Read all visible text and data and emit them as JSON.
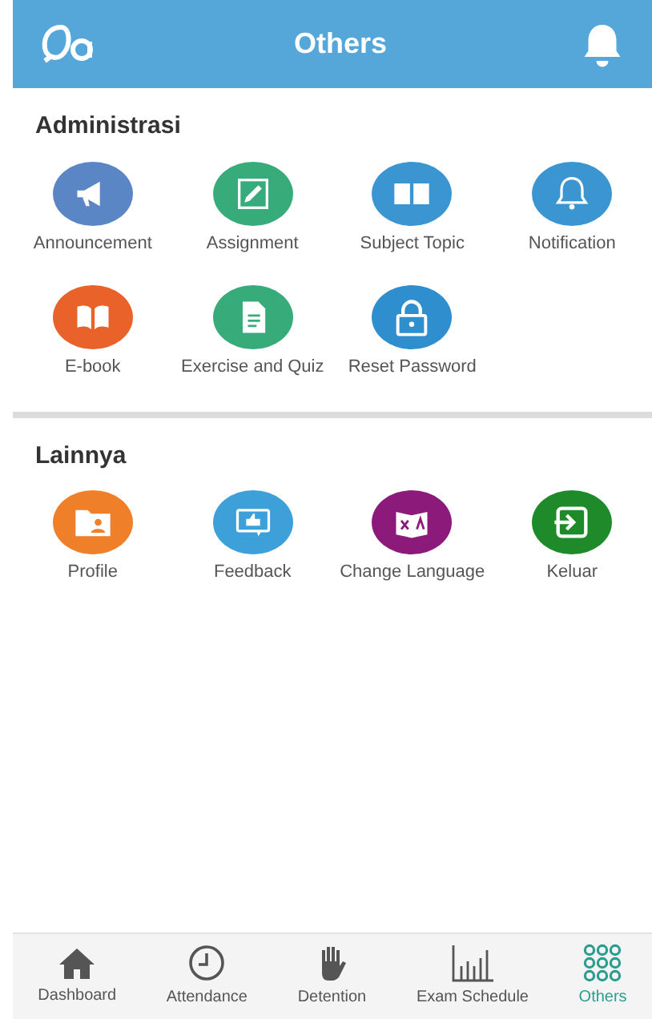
{
  "header": {
    "title": "Others"
  },
  "sections": [
    {
      "title": "Administrasi",
      "items": [
        {
          "label": "Announcement",
          "color": "#5b86c5"
        },
        {
          "label": "Assignment",
          "color": "#38ab7b"
        },
        {
          "label": "Subject Topic",
          "color": "#3b95d0"
        },
        {
          "label": "Notification",
          "color": "#3b95d0"
        },
        {
          "label": "E-book",
          "color": "#e8622a"
        },
        {
          "label": "Exercise and Quiz",
          "color": "#38ab7b"
        },
        {
          "label": "Reset Password",
          "color": "#2f8fce"
        }
      ]
    },
    {
      "title": "Lainnya",
      "items": [
        {
          "label": "Profile",
          "color": "#f07f2a"
        },
        {
          "label": "Feedback",
          "color": "#3da0d8"
        },
        {
          "label": "Change Language",
          "color": "#8b1a7a"
        },
        {
          "label": "Keluar",
          "color": "#1f8a2a"
        }
      ]
    }
  ],
  "nav": [
    {
      "label": "Dashboard",
      "selected": false
    },
    {
      "label": "Attendance",
      "selected": false
    },
    {
      "label": "Detention",
      "selected": false
    },
    {
      "label": "Exam Schedule",
      "selected": false
    },
    {
      "label": "Others",
      "selected": true
    }
  ]
}
